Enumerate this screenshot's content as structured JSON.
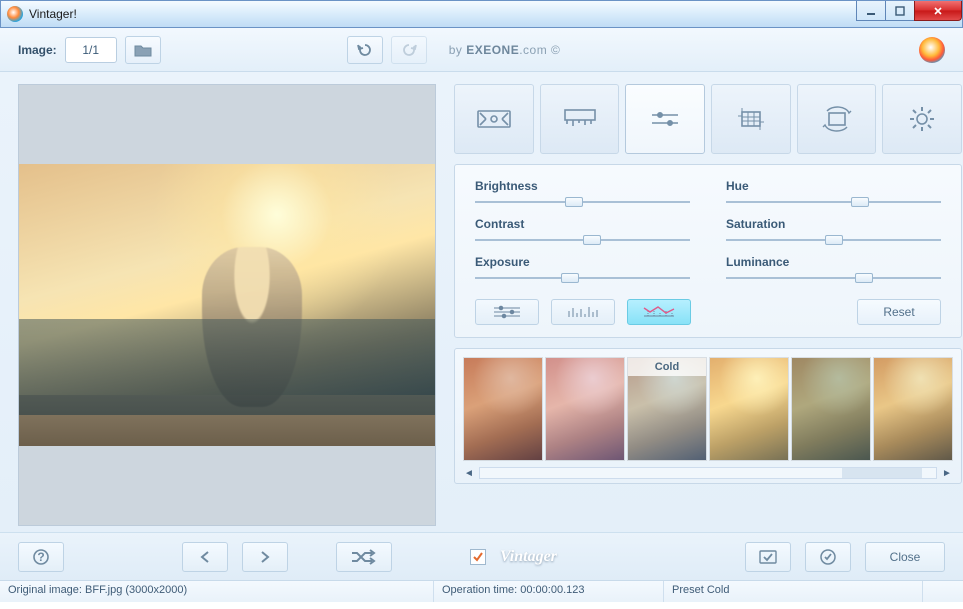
{
  "window": {
    "title": "Vintager!"
  },
  "toolbar": {
    "image_label": "Image:",
    "counter": "1/1",
    "credit_by": "by ",
    "credit_brand": "EXEONE",
    "credit_suffix": ".com ©"
  },
  "tabs": [
    "effects",
    "presets",
    "adjust",
    "crop",
    "rotate",
    "settings"
  ],
  "sliders": {
    "left": [
      {
        "label": "Brightness",
        "pos": 42
      },
      {
        "label": "Contrast",
        "pos": 50
      },
      {
        "label": "Exposure",
        "pos": 40
      }
    ],
    "right": [
      {
        "label": "Hue",
        "pos": 58
      },
      {
        "label": "Saturation",
        "pos": 46
      },
      {
        "label": "Luminance",
        "pos": 60
      }
    ],
    "reset": "Reset"
  },
  "presets": [
    {
      "tint": "rgba(170,60,60,.35)"
    },
    {
      "tint": "rgba(200,120,200,.35)"
    },
    {
      "tint": "rgba(120,150,200,.35)",
      "label": "Cold"
    },
    {
      "tint": "rgba(255,220,120,.3)"
    },
    {
      "tint": "rgba(90,110,90,.45)"
    },
    {
      "tint": "rgba(200,150,80,.25)"
    }
  ],
  "bottom": {
    "watermark_checked": true,
    "watermark_label": "Vintager",
    "close": "Close"
  },
  "status": {
    "original": "Original image: BFF.jpg (3000x2000)",
    "optime": "Operation time: 00:00:00.123",
    "preset": "Preset Cold"
  }
}
